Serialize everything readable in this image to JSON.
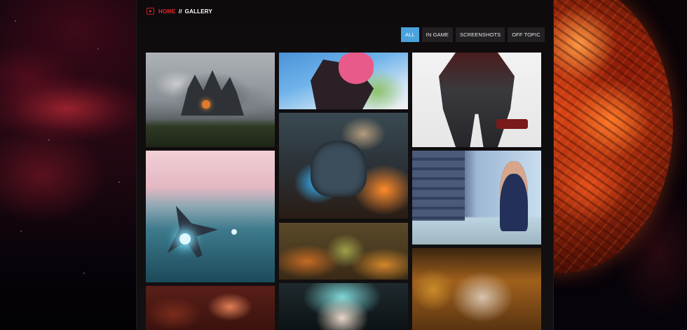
{
  "breadcrumb": {
    "home_label": "HOME",
    "separator": "//",
    "current_label": "GALLERY"
  },
  "filters": [
    {
      "label": "ALL",
      "active": true
    },
    {
      "label": "IN GAME",
      "active": false
    },
    {
      "label": "SCREENSHOTS",
      "active": false
    },
    {
      "label": "OFF TOPIC",
      "active": false
    }
  ],
  "colors": {
    "accent_red": "#e52626",
    "active_filter": "#4aa3dd",
    "filter_bg": "#222022",
    "panel_bg": "#121012"
  },
  "gallery": {
    "items": [
      {
        "subject": "giant-creature-landscape"
      },
      {
        "subject": "anime-character"
      },
      {
        "subject": "armored-mech"
      },
      {
        "subject": "jets-over-ocean"
      },
      {
        "subject": "robot-battle"
      },
      {
        "subject": "city-agent"
      },
      {
        "subject": "orc-battle"
      },
      {
        "subject": "fiery-creature"
      },
      {
        "subject": "white-haired-hero"
      },
      {
        "subject": "bearded-dwarf"
      }
    ]
  }
}
